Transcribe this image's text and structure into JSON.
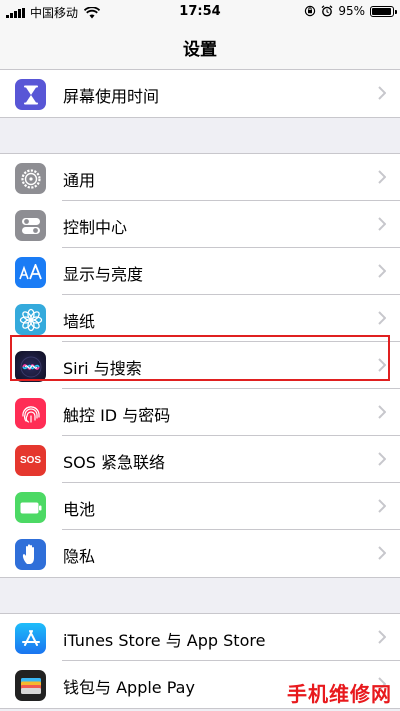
{
  "status_bar": {
    "carrier": "中国移动",
    "time": "17:54",
    "battery": "95%",
    "battery_level": 0.95
  },
  "nav": {
    "title": "设置"
  },
  "groups": [
    {
      "items": [
        {
          "label": "屏幕使用时间",
          "icon": "hourglass-icon",
          "color": "#5856d6"
        }
      ]
    },
    {
      "items": [
        {
          "label": "通用",
          "icon": "gear-icon",
          "color": "#8e8e93"
        },
        {
          "label": "控制中心",
          "icon": "toggles-icon",
          "color": "#8e8e93"
        },
        {
          "label": "显示与亮度",
          "icon": "text-size-icon",
          "color": "#1a7cf5"
        },
        {
          "label": "墙纸",
          "icon": "flower-icon",
          "color": "#34aadc"
        },
        {
          "label": "Siri 与搜索",
          "icon": "siri-icon",
          "color": "#1c1c3a"
        },
        {
          "label": "触控 ID 与密码",
          "icon": "fingerprint-icon",
          "color": "#ff2d55"
        },
        {
          "label": "SOS 紧急联络",
          "icon": "sos-icon",
          "color": "#e5372e"
        },
        {
          "label": "电池",
          "icon": "battery-icon",
          "color": "#4cd964"
        },
        {
          "label": "隐私",
          "icon": "hand-icon",
          "color": "#2f6fd9"
        }
      ]
    },
    {
      "items": [
        {
          "label": "iTunes Store 与 App Store",
          "icon": "app-store-icon",
          "color": "#1a8cf5"
        },
        {
          "label": "钱包与 Apple Pay",
          "icon": "wallet-icon",
          "color": "#222222"
        }
      ]
    }
  ],
  "sos_icon_text": "SOS",
  "watermark": "手机维修网"
}
